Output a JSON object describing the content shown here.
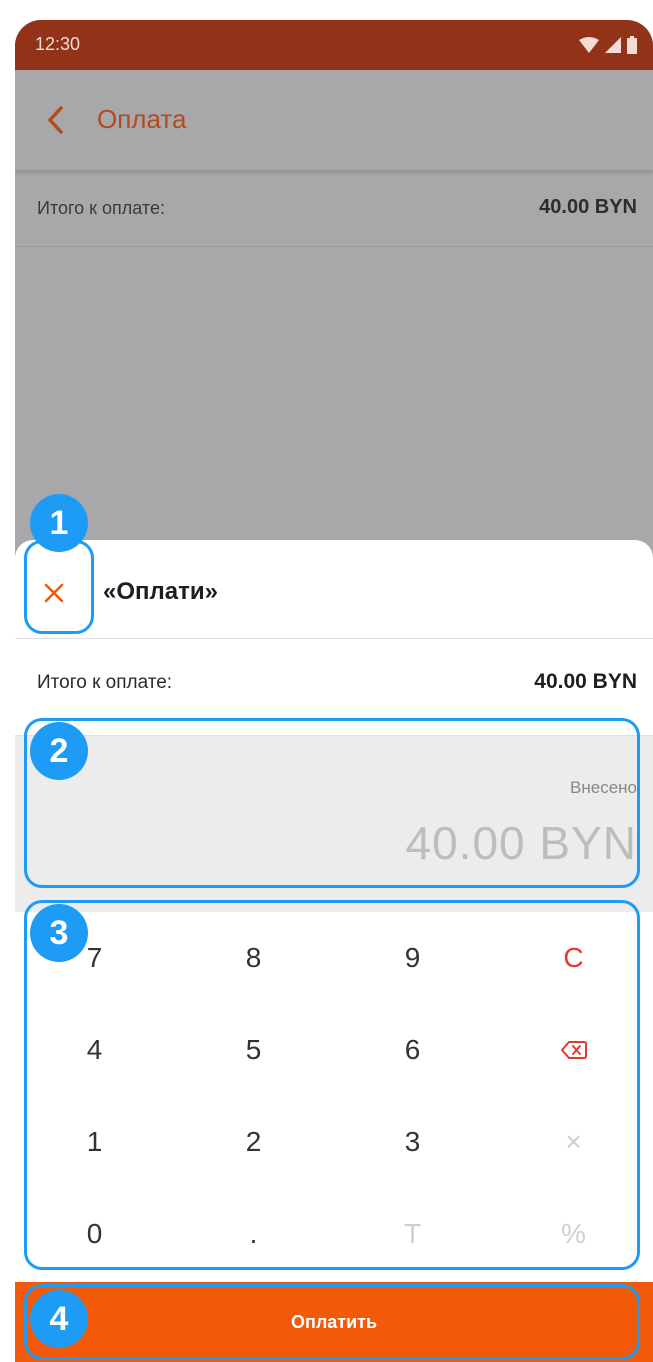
{
  "status_bar": {
    "time": "12:30"
  },
  "header": {
    "title": "Оплата"
  },
  "background_row": {
    "label": "Итого к оплате:",
    "value": "40.00 BYN"
  },
  "sheet": {
    "title": "«Оплати»",
    "total_label": "Итого к оплате:",
    "total_value": "40.00 BYN",
    "amount_label": "Внесено",
    "amount_value": "40.00 BYN"
  },
  "keypad": {
    "k7": "7",
    "k8": "8",
    "k9": "9",
    "clear": "C",
    "k4": "4",
    "k5": "5",
    "k6": "6",
    "k1": "1",
    "k2": "2",
    "k3": "3",
    "multiply": "×",
    "k0": "0",
    "dot": ".",
    "t": "T",
    "percent": "%"
  },
  "pay_button": {
    "label": "Оплатить"
  },
  "callouts": {
    "c1": "1",
    "c2": "2",
    "c3": "3",
    "c4": "4"
  },
  "colors": {
    "accent": "#f15a08",
    "status_bar": "#923219",
    "callout": "#1e9bf5",
    "clear_key": "#e63a2b"
  },
  "icons": [
    "back-chevron-icon",
    "close-icon",
    "backspace-icon",
    "wifi-icon",
    "signal-icon",
    "battery-icon"
  ]
}
